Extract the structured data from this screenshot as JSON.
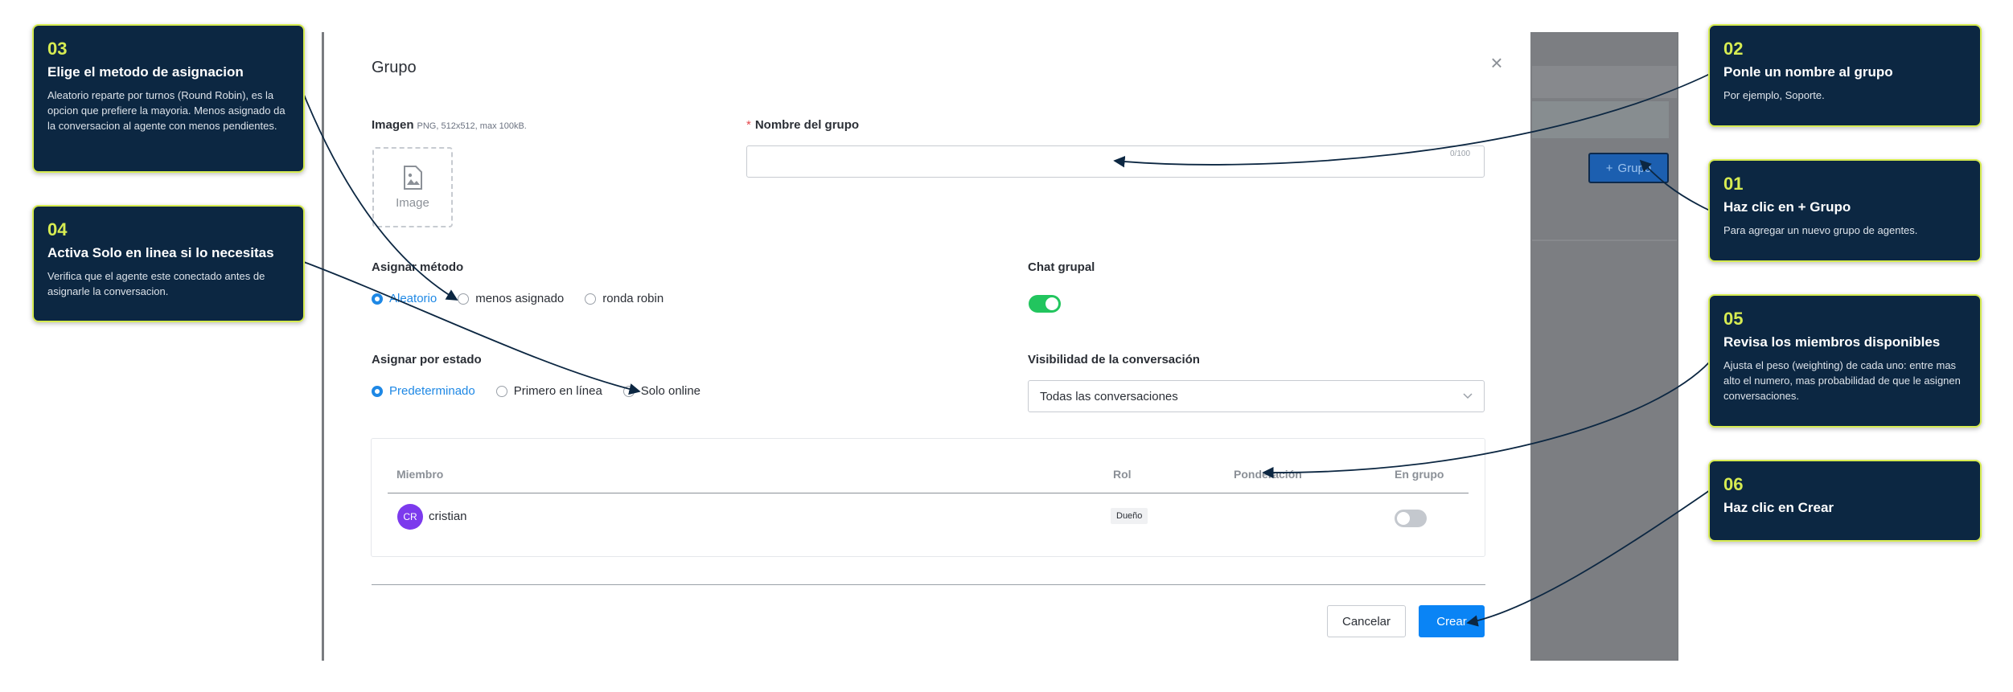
{
  "background": {
    "group_button_label": "Grupo",
    "group_button_icon": "plus-icon"
  },
  "modal": {
    "title": "Grupo",
    "close_icon": "close-icon",
    "image": {
      "label": "Imagen",
      "hint": "PNG, 512x512, max 100kB.",
      "placeholder": "Image",
      "icon": "image-icon"
    },
    "group_name": {
      "required_mark": "*",
      "label": "Nombre del grupo",
      "value": "",
      "counter": "0/100"
    },
    "assign_method": {
      "label": "Asignar método",
      "options": [
        "Aleatorio",
        "menos asignado",
        "ronda robin"
      ],
      "selected": "Aleatorio"
    },
    "group_chat": {
      "label": "Chat grupal",
      "enabled": true
    },
    "assign_by_status": {
      "label": "Asignar por estado",
      "options": [
        "Predeterminado",
        "Primero en línea",
        "Solo online"
      ],
      "selected": "Predeterminado"
    },
    "visibility": {
      "label": "Visibilidad de la conversación",
      "value": "Todas las conversaciones"
    },
    "members": {
      "headers": [
        "Miembro",
        "Rol",
        "Ponderación",
        "En grupo"
      ],
      "rows": [
        {
          "initials": "CR",
          "name": "cristian",
          "role": "Dueño",
          "in_group": false
        }
      ]
    },
    "cancel_label": "Cancelar",
    "create_label": "Crear"
  },
  "callouts": [
    {
      "num": "03",
      "title": "Elige el metodo de asignacion",
      "desc": "Aleatorio reparte por turnos (Round Robin), es la opcion que prefiere la mayoria. Menos asignado da la conversacion al agente con menos pendientes."
    },
    {
      "num": "04",
      "title": "Activa Solo en linea si lo necesitas",
      "desc": "Verifica que el agente este conectado antes de asignarle la conversacion."
    },
    {
      "num": "02",
      "title": "Ponle un nombre al grupo",
      "desc": "Por ejemplo, Soporte."
    },
    {
      "num": "01",
      "title": "Haz clic en + Grupo",
      "desc": "Para agregar un nuevo grupo de agentes."
    },
    {
      "num": "05",
      "title": "Revisa los miembros disponibles",
      "desc": "Ajusta el peso (weighting) de cada uno: entre mas alto el numero, mas probabilidad de que le asignen conversaciones."
    },
    {
      "num": "06",
      "title": "Haz clic en Crear",
      "desc": ""
    }
  ],
  "colors": {
    "callout_bg": "#0c2742",
    "callout_border": "#d7ec52",
    "accent": "#1e88e5",
    "primary_button": "#0a84f5",
    "toggle_on": "#22c55e",
    "avatar": "#7c3aed",
    "required": "#e5484d"
  }
}
